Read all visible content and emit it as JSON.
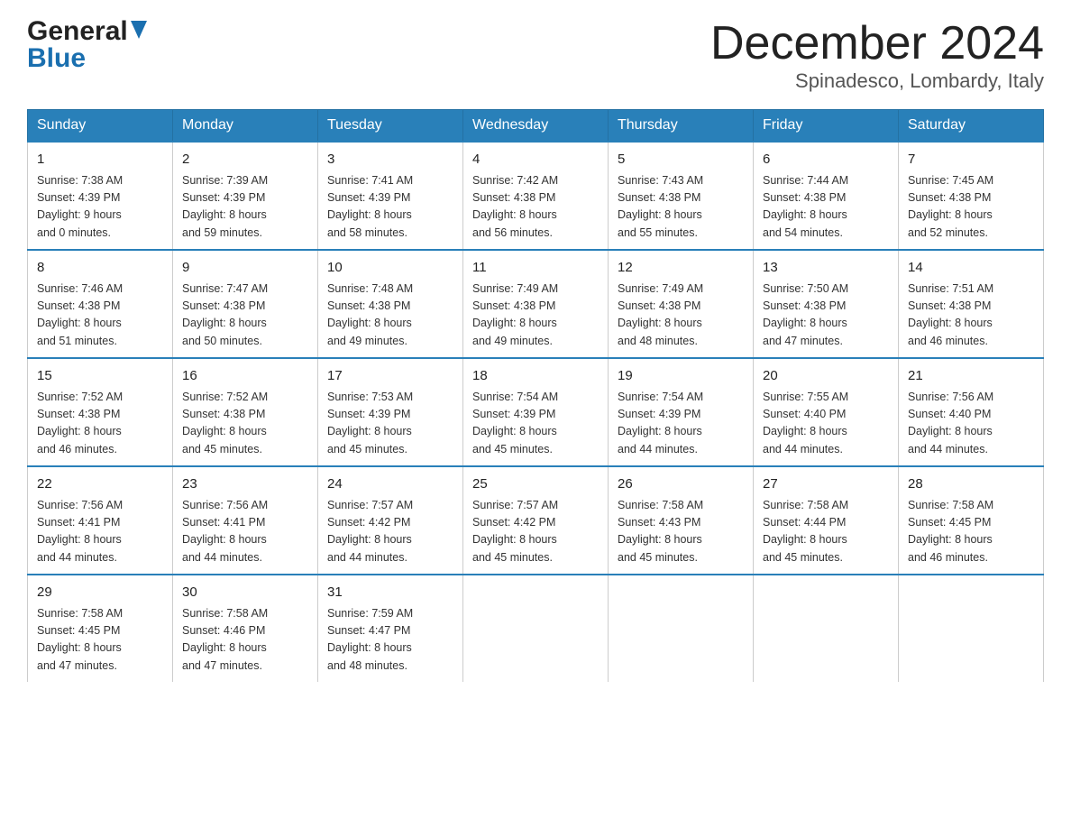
{
  "header": {
    "logo_general": "General",
    "logo_blue": "Blue",
    "title": "December 2024",
    "location": "Spinadesco, Lombardy, Italy"
  },
  "days_of_week": [
    "Sunday",
    "Monday",
    "Tuesday",
    "Wednesday",
    "Thursday",
    "Friday",
    "Saturday"
  ],
  "weeks": [
    [
      {
        "day": "1",
        "sunrise": "7:38 AM",
        "sunset": "4:39 PM",
        "daylight": "9 hours and 0 minutes."
      },
      {
        "day": "2",
        "sunrise": "7:39 AM",
        "sunset": "4:39 PM",
        "daylight": "8 hours and 59 minutes."
      },
      {
        "day": "3",
        "sunrise": "7:41 AM",
        "sunset": "4:39 PM",
        "daylight": "8 hours and 58 minutes."
      },
      {
        "day": "4",
        "sunrise": "7:42 AM",
        "sunset": "4:38 PM",
        "daylight": "8 hours and 56 minutes."
      },
      {
        "day": "5",
        "sunrise": "7:43 AM",
        "sunset": "4:38 PM",
        "daylight": "8 hours and 55 minutes."
      },
      {
        "day": "6",
        "sunrise": "7:44 AM",
        "sunset": "4:38 PM",
        "daylight": "8 hours and 54 minutes."
      },
      {
        "day": "7",
        "sunrise": "7:45 AM",
        "sunset": "4:38 PM",
        "daylight": "8 hours and 52 minutes."
      }
    ],
    [
      {
        "day": "8",
        "sunrise": "7:46 AM",
        "sunset": "4:38 PM",
        "daylight": "8 hours and 51 minutes."
      },
      {
        "day": "9",
        "sunrise": "7:47 AM",
        "sunset": "4:38 PM",
        "daylight": "8 hours and 50 minutes."
      },
      {
        "day": "10",
        "sunrise": "7:48 AM",
        "sunset": "4:38 PM",
        "daylight": "8 hours and 49 minutes."
      },
      {
        "day": "11",
        "sunrise": "7:49 AM",
        "sunset": "4:38 PM",
        "daylight": "8 hours and 49 minutes."
      },
      {
        "day": "12",
        "sunrise": "7:49 AM",
        "sunset": "4:38 PM",
        "daylight": "8 hours and 48 minutes."
      },
      {
        "day": "13",
        "sunrise": "7:50 AM",
        "sunset": "4:38 PM",
        "daylight": "8 hours and 47 minutes."
      },
      {
        "day": "14",
        "sunrise": "7:51 AM",
        "sunset": "4:38 PM",
        "daylight": "8 hours and 46 minutes."
      }
    ],
    [
      {
        "day": "15",
        "sunrise": "7:52 AM",
        "sunset": "4:38 PM",
        "daylight": "8 hours and 46 minutes."
      },
      {
        "day": "16",
        "sunrise": "7:52 AM",
        "sunset": "4:38 PM",
        "daylight": "8 hours and 45 minutes."
      },
      {
        "day": "17",
        "sunrise": "7:53 AM",
        "sunset": "4:39 PM",
        "daylight": "8 hours and 45 minutes."
      },
      {
        "day": "18",
        "sunrise": "7:54 AM",
        "sunset": "4:39 PM",
        "daylight": "8 hours and 45 minutes."
      },
      {
        "day": "19",
        "sunrise": "7:54 AM",
        "sunset": "4:39 PM",
        "daylight": "8 hours and 44 minutes."
      },
      {
        "day": "20",
        "sunrise": "7:55 AM",
        "sunset": "4:40 PM",
        "daylight": "8 hours and 44 minutes."
      },
      {
        "day": "21",
        "sunrise": "7:56 AM",
        "sunset": "4:40 PM",
        "daylight": "8 hours and 44 minutes."
      }
    ],
    [
      {
        "day": "22",
        "sunrise": "7:56 AM",
        "sunset": "4:41 PM",
        "daylight": "8 hours and 44 minutes."
      },
      {
        "day": "23",
        "sunrise": "7:56 AM",
        "sunset": "4:41 PM",
        "daylight": "8 hours and 44 minutes."
      },
      {
        "day": "24",
        "sunrise": "7:57 AM",
        "sunset": "4:42 PM",
        "daylight": "8 hours and 44 minutes."
      },
      {
        "day": "25",
        "sunrise": "7:57 AM",
        "sunset": "4:42 PM",
        "daylight": "8 hours and 45 minutes."
      },
      {
        "day": "26",
        "sunrise": "7:58 AM",
        "sunset": "4:43 PM",
        "daylight": "8 hours and 45 minutes."
      },
      {
        "day": "27",
        "sunrise": "7:58 AM",
        "sunset": "4:44 PM",
        "daylight": "8 hours and 45 minutes."
      },
      {
        "day": "28",
        "sunrise": "7:58 AM",
        "sunset": "4:45 PM",
        "daylight": "8 hours and 46 minutes."
      }
    ],
    [
      {
        "day": "29",
        "sunrise": "7:58 AM",
        "sunset": "4:45 PM",
        "daylight": "8 hours and 47 minutes."
      },
      {
        "day": "30",
        "sunrise": "7:58 AM",
        "sunset": "4:46 PM",
        "daylight": "8 hours and 47 minutes."
      },
      {
        "day": "31",
        "sunrise": "7:59 AM",
        "sunset": "4:47 PM",
        "daylight": "8 hours and 48 minutes."
      },
      null,
      null,
      null,
      null
    ]
  ],
  "labels": {
    "sunrise": "Sunrise:",
    "sunset": "Sunset:",
    "daylight": "Daylight:"
  },
  "colors": {
    "header_bg": "#2980b9",
    "accent": "#1a6faf"
  }
}
